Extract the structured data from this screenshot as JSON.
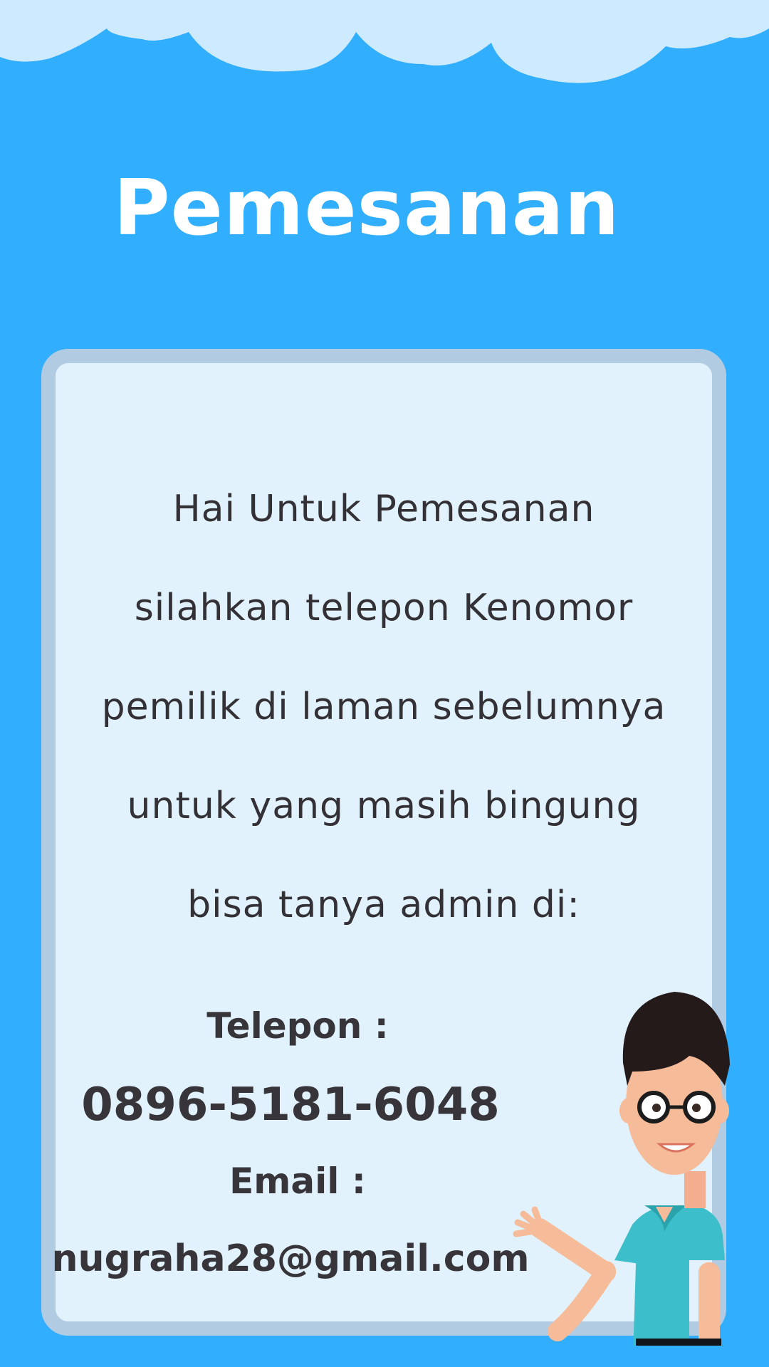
{
  "page": {
    "title": "Pemesanan"
  },
  "message": {
    "lines": [
      "Hai Untuk Pemesanan",
      "silahkan telepon Kenomor",
      "pemilik di laman sebelumnya",
      "untuk yang masih bingung",
      "bisa tanya admin di:"
    ]
  },
  "contact": {
    "phone_label": "Telepon :",
    "phone_number": "0896-5181-6048",
    "email_label": "Email :",
    "email_address": "nugraha28@gmail.com"
  },
  "icons": {
    "clouds": "cloud-border-icon",
    "character": "man-waving-icon"
  },
  "colors": {
    "background": "#31aefd",
    "cloud": "#cdeafe",
    "card_fill": "#e1f2fd",
    "card_border": "#b1cce2",
    "title": "#ffffff",
    "text": "#333135"
  }
}
